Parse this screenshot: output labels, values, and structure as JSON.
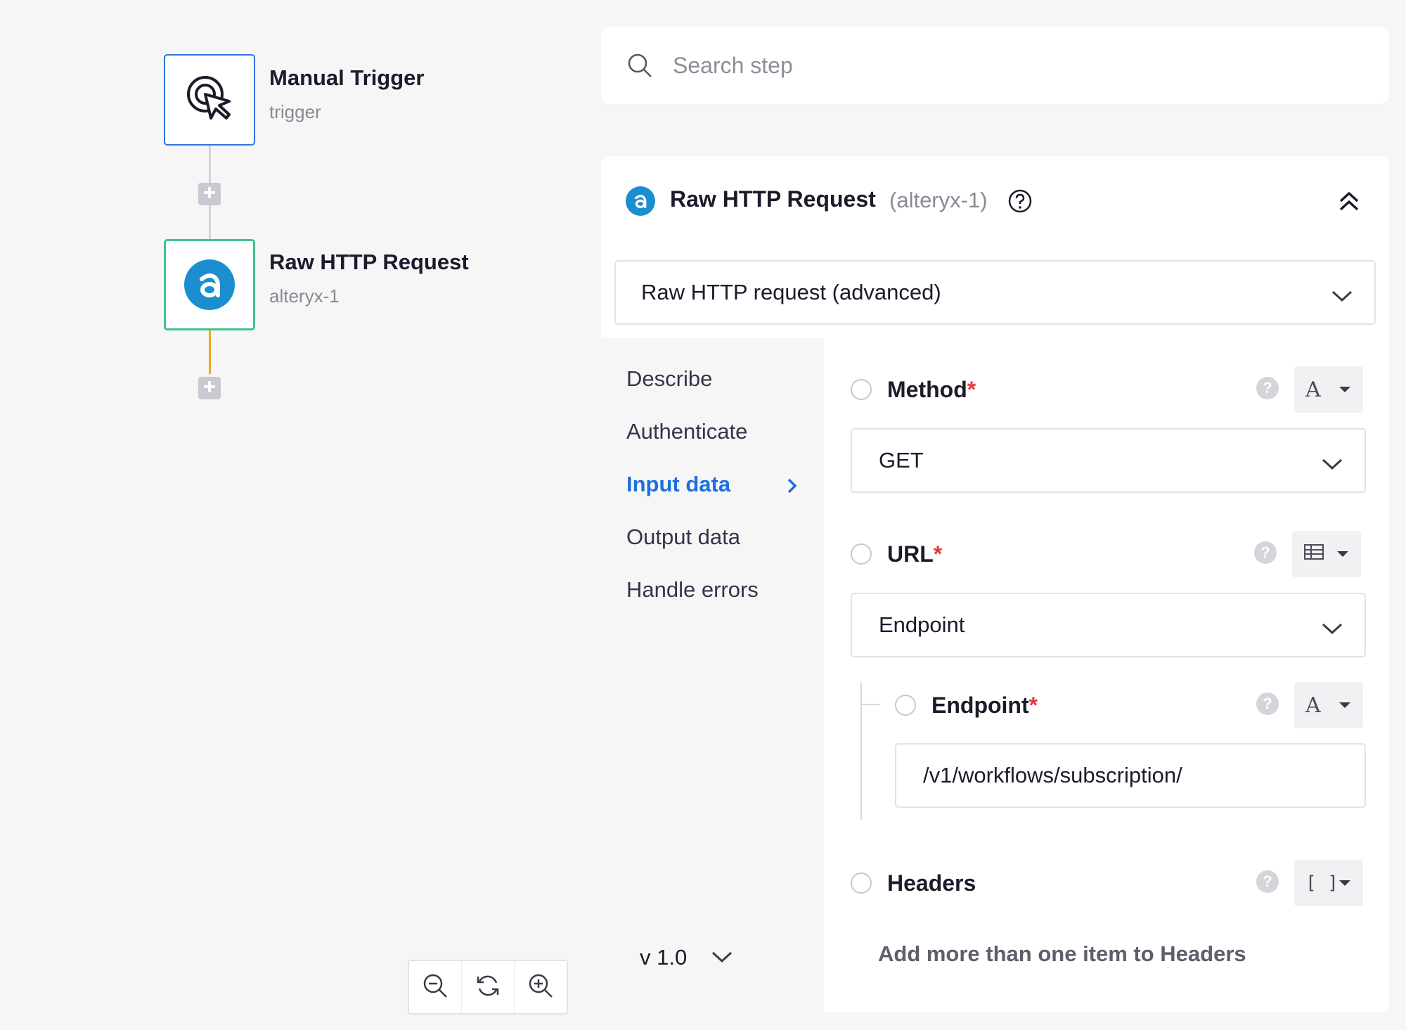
{
  "canvas": {
    "nodes": [
      {
        "title": "Manual Trigger",
        "subtitle": "trigger"
      },
      {
        "title": "Raw HTTP Request",
        "subtitle": "alteryx-1"
      }
    ],
    "zoom_controls": [
      "zoom-out",
      "reset",
      "zoom-in"
    ]
  },
  "search": {
    "placeholder": "Search step"
  },
  "panel": {
    "title": "Raw HTTP Request",
    "step_id": "(alteryx-1)",
    "action": "Raw HTTP request (advanced)",
    "nav": [
      "Describe",
      "Authenticate",
      "Input data",
      "Output data",
      "Handle errors"
    ],
    "active_nav": "Input data",
    "version": "v 1.0",
    "fields": {
      "method": {
        "label": "Method",
        "required": "*",
        "type_glyph": "A",
        "value": "GET"
      },
      "url": {
        "label": "URL",
        "required": "*",
        "value": "Endpoint"
      },
      "endpoint": {
        "label": "Endpoint",
        "required": "*",
        "type_glyph": "A",
        "value": "/v1/workflows/subscription/"
      },
      "headers": {
        "label": "Headers",
        "type_glyph": "[ ]",
        "hint": "Add more than one item to Headers"
      }
    }
  },
  "colors": {
    "accent_blue": "#1d6fe0",
    "trigger_border": "#2f73e0",
    "active_node_border": "#3ec38b",
    "connector_orange": "#f2a81d",
    "alteryx_blue": "#1b8ed0",
    "required_red": "#e0393e"
  }
}
